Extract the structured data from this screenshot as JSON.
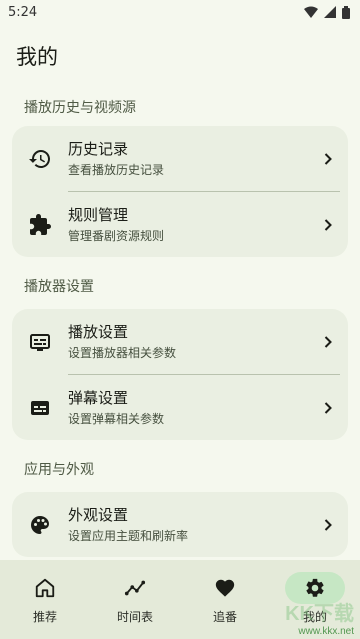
{
  "status_bar": {
    "time": "5:24"
  },
  "page": {
    "title": "我的"
  },
  "sections": [
    {
      "header": "播放历史与视频源",
      "items": [
        {
          "title": "历史记录",
          "subtitle": "查看播放历史记录",
          "icon": "history-icon"
        },
        {
          "title": "规则管理",
          "subtitle": "管理番剧资源规则",
          "icon": "extension-icon"
        }
      ]
    },
    {
      "header": "播放器设置",
      "items": [
        {
          "title": "播放设置",
          "subtitle": "设置播放器相关参数",
          "icon": "subtitles-icon"
        },
        {
          "title": "弹幕设置",
          "subtitle": "设置弹幕相关参数",
          "icon": "danmaku-icon"
        }
      ]
    },
    {
      "header": "应用与外观",
      "items": [
        {
          "title": "外观设置",
          "subtitle": "设置应用主题和刷新率",
          "icon": "palette-icon"
        }
      ]
    }
  ],
  "bottom_nav": [
    {
      "label": "推荐",
      "icon": "home-icon",
      "active": false
    },
    {
      "label": "时间表",
      "icon": "timeline-icon",
      "active": false
    },
    {
      "label": "追番",
      "icon": "heart-icon",
      "active": false
    },
    {
      "label": "我的",
      "icon": "gear-icon",
      "active": true
    }
  ],
  "watermark": {
    "text": "KK下载",
    "url": "www.kkx.net"
  },
  "colors": {
    "background": "#f5f8ee",
    "card": "#eaefe2",
    "nav_active": "#c6e7c4"
  }
}
